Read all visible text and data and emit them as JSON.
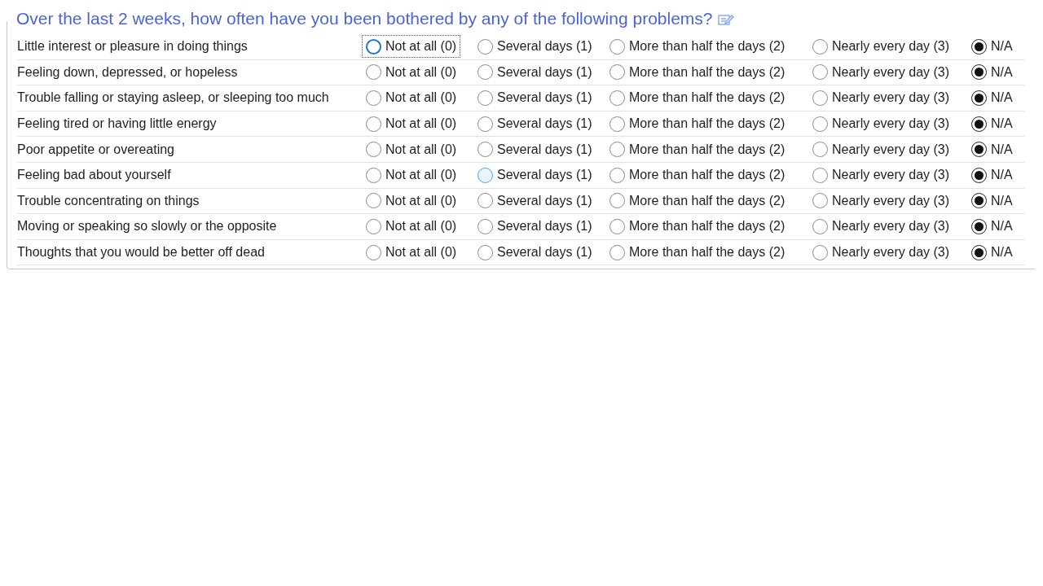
{
  "title": "Over the last 2 weeks, how often have you been bothered by any of the following problems?",
  "rows": [
    {
      "question": "Little interest or pleasure in doing things",
      "options": [
        {
          "label": "Not at all (0)",
          "selected": false,
          "focused": true,
          "hovered": false
        },
        {
          "label": "Several days (1)",
          "selected": false,
          "focused": false,
          "hovered": false
        },
        {
          "label": "More than half the days (2)",
          "selected": false,
          "focused": false,
          "hovered": false
        },
        {
          "label": "Nearly every day (3)",
          "selected": false,
          "focused": false,
          "hovered": false
        },
        {
          "label": "N/A",
          "selected": true,
          "focused": false,
          "hovered": false
        }
      ]
    },
    {
      "question": "Feeling down, depressed, or hopeless",
      "options": [
        {
          "label": "Not at all (0)",
          "selected": false,
          "focused": false,
          "hovered": false
        },
        {
          "label": "Several days (1)",
          "selected": false,
          "focused": false,
          "hovered": false
        },
        {
          "label": "More than half the days (2)",
          "selected": false,
          "focused": false,
          "hovered": false
        },
        {
          "label": "Nearly every day (3)",
          "selected": false,
          "focused": false,
          "hovered": false
        },
        {
          "label": "N/A",
          "selected": true,
          "focused": false,
          "hovered": false
        }
      ]
    },
    {
      "question": "Trouble falling or staying asleep, or sleeping too much",
      "options": [
        {
          "label": "Not at all (0)",
          "selected": false,
          "focused": false,
          "hovered": false
        },
        {
          "label": "Several days (1)",
          "selected": false,
          "focused": false,
          "hovered": false
        },
        {
          "label": "More than half the days (2)",
          "selected": false,
          "focused": false,
          "hovered": false
        },
        {
          "label": "Nearly every day (3)",
          "selected": false,
          "focused": false,
          "hovered": false
        },
        {
          "label": "N/A",
          "selected": true,
          "focused": false,
          "hovered": false
        }
      ]
    },
    {
      "question": "Feeling tired or having little energy",
      "options": [
        {
          "label": "Not at all (0)",
          "selected": false,
          "focused": false,
          "hovered": false
        },
        {
          "label": "Several days (1)",
          "selected": false,
          "focused": false,
          "hovered": false
        },
        {
          "label": "More than half the days (2)",
          "selected": false,
          "focused": false,
          "hovered": false
        },
        {
          "label": "Nearly every day (3)",
          "selected": false,
          "focused": false,
          "hovered": false
        },
        {
          "label": "N/A",
          "selected": true,
          "focused": false,
          "hovered": false
        }
      ]
    },
    {
      "question": "Poor appetite or overeating",
      "options": [
        {
          "label": "Not at all (0)",
          "selected": false,
          "focused": false,
          "hovered": false
        },
        {
          "label": "Several days (1)",
          "selected": false,
          "focused": false,
          "hovered": false
        },
        {
          "label": "More than half the days (2)",
          "selected": false,
          "focused": false,
          "hovered": false
        },
        {
          "label": "Nearly every day (3)",
          "selected": false,
          "focused": false,
          "hovered": false
        },
        {
          "label": "N/A",
          "selected": true,
          "focused": false,
          "hovered": false
        }
      ]
    },
    {
      "question": "Feeling bad about yourself",
      "options": [
        {
          "label": "Not at all (0)",
          "selected": false,
          "focused": false,
          "hovered": false
        },
        {
          "label": "Several days (1)",
          "selected": false,
          "focused": false,
          "hovered": true
        },
        {
          "label": "More than half the days (2)",
          "selected": false,
          "focused": false,
          "hovered": false
        },
        {
          "label": "Nearly every day (3)",
          "selected": false,
          "focused": false,
          "hovered": false
        },
        {
          "label": "N/A",
          "selected": true,
          "focused": false,
          "hovered": false
        }
      ]
    },
    {
      "question": "Trouble concentrating on things",
      "options": [
        {
          "label": "Not at all (0)",
          "selected": false,
          "focused": false,
          "hovered": false
        },
        {
          "label": "Several days (1)",
          "selected": false,
          "focused": false,
          "hovered": false
        },
        {
          "label": "More than half the days (2)",
          "selected": false,
          "focused": false,
          "hovered": false
        },
        {
          "label": "Nearly every day (3)",
          "selected": false,
          "focused": false,
          "hovered": false
        },
        {
          "label": "N/A",
          "selected": true,
          "focused": false,
          "hovered": false
        }
      ]
    },
    {
      "question": "Moving or speaking so slowly or the opposite",
      "options": [
        {
          "label": "Not at all (0)",
          "selected": false,
          "focused": false,
          "hovered": false
        },
        {
          "label": "Several days (1)",
          "selected": false,
          "focused": false,
          "hovered": false
        },
        {
          "label": "More than half the days (2)",
          "selected": false,
          "focused": false,
          "hovered": false
        },
        {
          "label": "Nearly every day (3)",
          "selected": false,
          "focused": false,
          "hovered": false
        },
        {
          "label": "N/A",
          "selected": true,
          "focused": false,
          "hovered": false
        }
      ]
    },
    {
      "question": "Thoughts that you would be better off dead",
      "options": [
        {
          "label": "Not at all (0)",
          "selected": false,
          "focused": false,
          "hovered": false
        },
        {
          "label": "Several days (1)",
          "selected": false,
          "focused": false,
          "hovered": false
        },
        {
          "label": "More than half the days (2)",
          "selected": false,
          "focused": false,
          "hovered": false
        },
        {
          "label": "Nearly every day (3)",
          "selected": false,
          "focused": false,
          "hovered": false
        },
        {
          "label": "N/A",
          "selected": true,
          "focused": false,
          "hovered": false
        }
      ]
    }
  ]
}
